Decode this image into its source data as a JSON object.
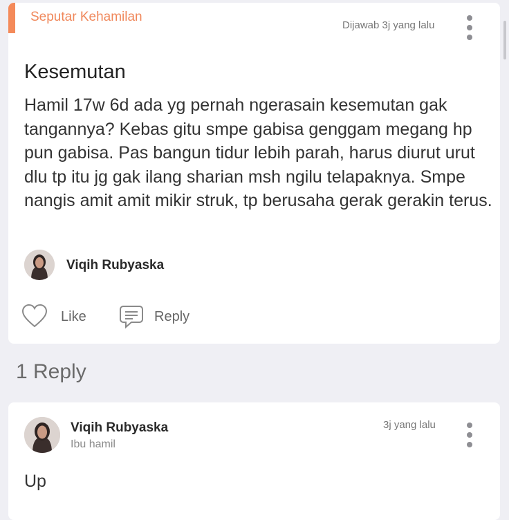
{
  "post": {
    "category": "Seputar Kehamilan",
    "time": "Dijawab 3j yang lalu",
    "title": "Kesemutan",
    "body": "Hamil 17w 6d ada yg pernah ngerasain kesemutan gak tangannya? Kebas gitu smpe gabisa genggam megang hp pun gabisa. Pas bangun tidur lebih parah, harus diurut urut dlu tp itu jg gak ilang sharian msh ngilu telapaknya. Smpe nangis amit amit mikir struk, tp berusaha gerak gerakin terus.",
    "author": "Viqih Rubyaska",
    "like_label": "Like",
    "reply_label": "Reply",
    "more_icon": "more-vertical-icon"
  },
  "replies": {
    "count_label": "1 Reply",
    "items": [
      {
        "author": "Viqih Rubyaska",
        "subtitle": "Ibu hamil",
        "time": "3j yang lalu",
        "text": "Up"
      }
    ]
  },
  "colors": {
    "accent": "#f0875a",
    "background": "#efeff4",
    "card": "#ffffff"
  }
}
